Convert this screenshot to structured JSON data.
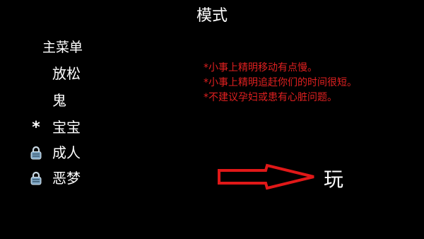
{
  "header": {
    "title": "模式"
  },
  "menu": {
    "main_menu_label": "主菜单"
  },
  "modes": [
    {
      "label": "放松",
      "marker": ""
    },
    {
      "label": "鬼",
      "marker": ""
    },
    {
      "label": "宝宝",
      "marker": "*"
    },
    {
      "label": "成人",
      "marker": "lock-icon"
    },
    {
      "label": "恶梦",
      "marker": "lock-icon"
    }
  ],
  "warnings": {
    "lines": [
      "*小事上精明移动有点慢。",
      "*小事上精明追赶你们的时间很短。",
      "*不建议孕妇或患有心脏问题。"
    ],
    "color": "#e02020"
  },
  "play": {
    "label": "玩"
  },
  "colors": {
    "background": "#000000",
    "text": "#ffffff",
    "arrow": "#e01818",
    "lock": "#8fb4cf"
  }
}
